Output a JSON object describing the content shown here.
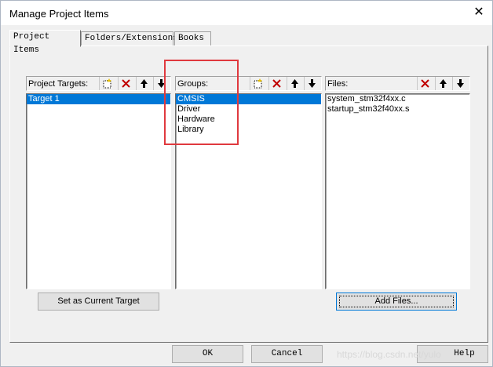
{
  "window": {
    "title": "Manage Project Items",
    "close_glyph": "✕"
  },
  "tabs": [
    {
      "label": "Project Items",
      "active": true
    },
    {
      "label": "Folders/Extensions",
      "active": false
    },
    {
      "label": "Books",
      "active": false
    }
  ],
  "targets": {
    "header": "Project Targets:",
    "items": [
      "Target 1"
    ],
    "selected_index": 0,
    "set_current_button": "Set as Current Target"
  },
  "groups": {
    "header": "Groups:",
    "items": [
      "CMSIS",
      "Driver",
      "Hardware",
      "Library"
    ],
    "selected_index": 0
  },
  "files": {
    "header": "Files:",
    "items": [
      "system_stm32f4xx.c",
      "startup_stm32f40xx.s"
    ],
    "add_files_button": "Add Files..."
  },
  "footer": {
    "ok": "OK",
    "cancel": "Cancel",
    "help": "Help"
  },
  "watermark": "https://blog.csdn.net/yulo",
  "colors": {
    "selection": "#0078d7",
    "annotation_box": "#e0393e"
  },
  "icons": [
    "new-item-icon",
    "delete-icon",
    "move-up-icon",
    "move-down-icon",
    "close-icon"
  ]
}
